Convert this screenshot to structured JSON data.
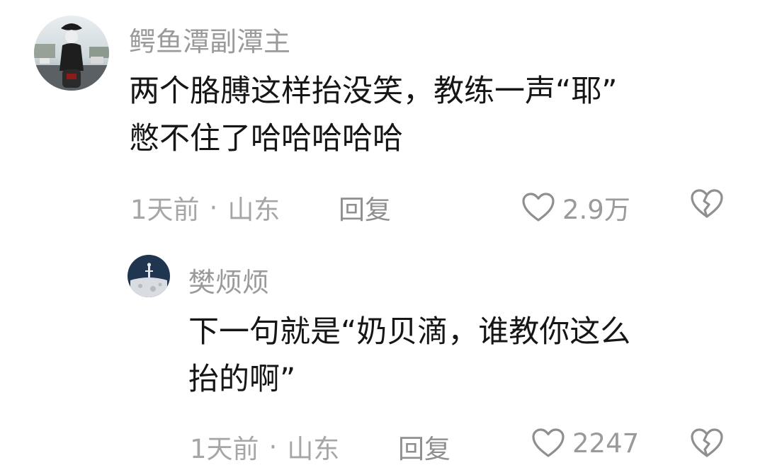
{
  "comments": [
    {
      "username": "鳄鱼潭副潭主",
      "text_line1": "两个胳膊这样抬没笑，教练一声“耶”",
      "text_line2": "憋不住了哈哈哈哈哈",
      "time": "1天前",
      "separator": "·",
      "location": "山东",
      "reply_label": "回复",
      "likes": "2.9万"
    },
    {
      "username": "樊烦烦",
      "text_line1": "下一句就是“奶贝滴，谁教你这么",
      "text_line2": "抬的啊”",
      "time": "1天前",
      "separator": "·",
      "location": "山东",
      "reply_label": "回复",
      "likes": "2247"
    }
  ],
  "icons": {
    "like": "heart-outline-icon",
    "dislike": "broken-heart-icon"
  },
  "colors": {
    "username": "#9a9a9a",
    "content": "#161616",
    "meta": "#a6a6a6",
    "icon": "#9a9a9a"
  }
}
